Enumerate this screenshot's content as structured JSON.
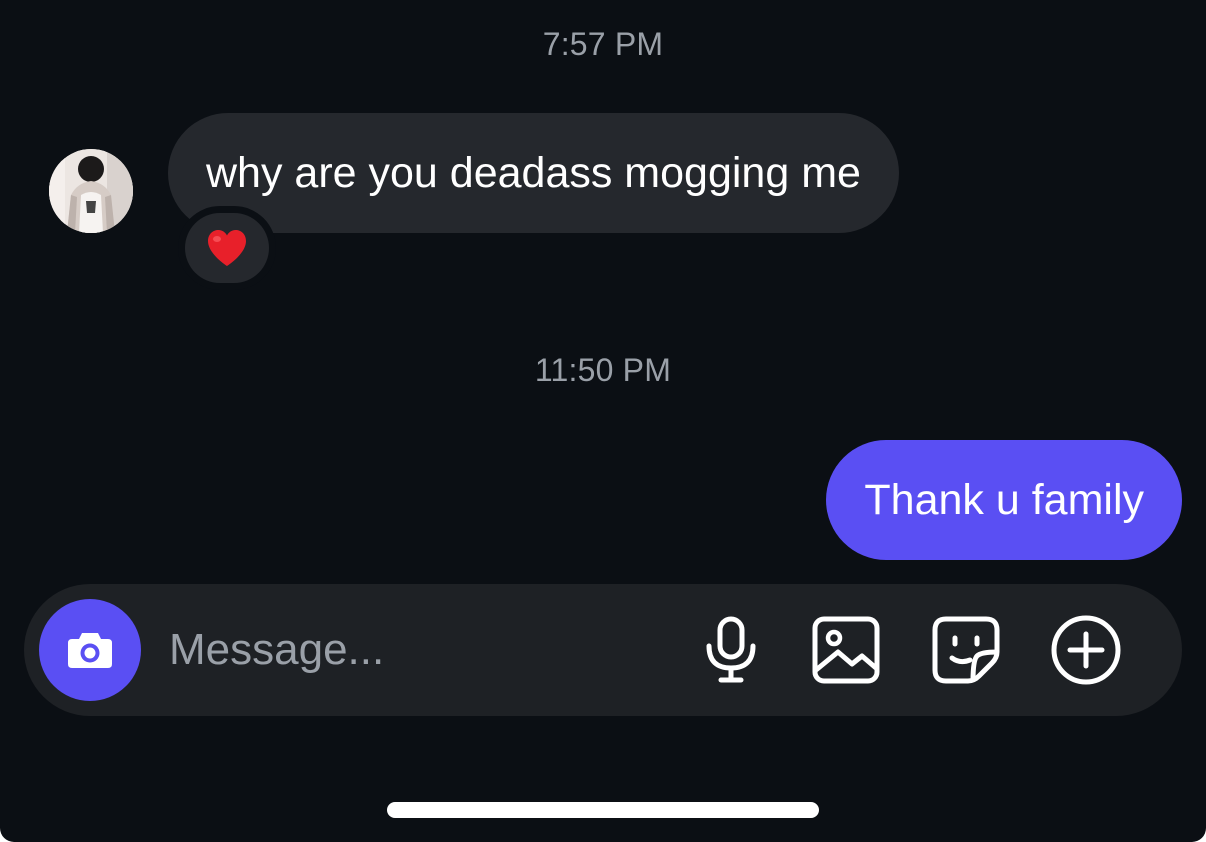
{
  "conversation": {
    "messages": [
      {
        "timestamp": "7:57 PM",
        "direction": "incoming",
        "text": "why are you deadass mogging me",
        "reaction": "heart-emoji"
      },
      {
        "timestamp": "11:50 PM",
        "direction": "outgoing",
        "text": "Thank u family"
      }
    ]
  },
  "composer": {
    "placeholder": "Message...",
    "value": "",
    "icons": [
      "camera-icon",
      "microphone-icon",
      "gallery-icon",
      "sticker-icon",
      "plus-icon"
    ]
  },
  "colors": {
    "background": "#0b0f14",
    "incoming_bubble": "#25282d",
    "outgoing_bubble": "#5a4ff3",
    "composer": "#1e2125",
    "timestamp": "#9aa0a8",
    "reaction_heart": "#e8202a"
  }
}
